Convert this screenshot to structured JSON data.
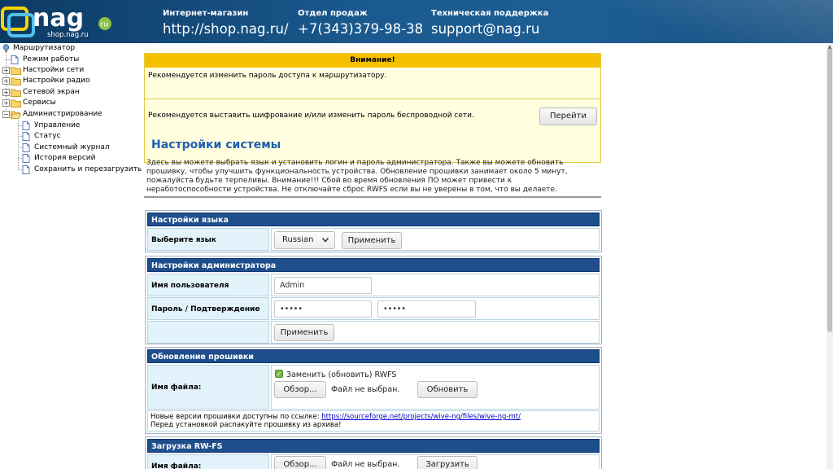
{
  "header": {
    "logo_text": "nag",
    "logo_ru": "ru",
    "logo_sub": "shop.nag.ru",
    "shop": {
      "title": "Интернет-магазин",
      "value": "http://shop.nag.ru/"
    },
    "sales": {
      "title": "Отдел продаж",
      "value": "+7(343)379-98-38"
    },
    "support": {
      "title": "Техническая поддержка",
      "value": "support@nag.ru"
    }
  },
  "tree": {
    "root": "Маршрутизатор",
    "items": [
      {
        "label": "Режим работы"
      },
      {
        "label": "Настройки сети"
      },
      {
        "label": "Настройки радио"
      },
      {
        "label": "Сетевой экран"
      },
      {
        "label": "Сервисы"
      },
      {
        "label": "Администрирование"
      },
      {
        "label": "Управление"
      },
      {
        "label": "Статус"
      },
      {
        "label": "Системный журнал"
      },
      {
        "label": "История версий"
      },
      {
        "label": "Сохранить и перезагрузить"
      }
    ]
  },
  "warning": {
    "title": "Внимание!",
    "msg1": "Рекомендуется изменить пароль доступа к маршрутизатору.",
    "msg2": "Рекомендуется выставить шифрование и/или изменить пароль беспроводной сети.",
    "go_button": "Перейти"
  },
  "system": {
    "title": "Настройки системы",
    "description": "Здесь вы можете выбрать язык и установить логин и пароль администратора. Также вы можете обновить прошивку, чтобы улучшить функциональность устройства. Обновление прошивки занимает около 5 минут, пожалуйста будьте терпеливы. Внимание!!! Сбой во время обновления ПО может привести к неработоспособности устройства. Не отключайте сброс RWFS если вы не уверены в том, что вы делаете."
  },
  "language": {
    "header": "Настройки языка",
    "label": "Выберите язык",
    "selected": "Russian",
    "apply": "Применить"
  },
  "admin": {
    "header": "Настройки администратора",
    "user_label": "Имя пользователя",
    "user_value": "Admin",
    "pass_label": "Пароль / Подтверждение",
    "pass_value": "•••••",
    "pass_confirm": "•••••",
    "apply": "Применить"
  },
  "firmware": {
    "header": "Обновление прошивки",
    "file_label": "Имя файла:",
    "rwfs_label": "Заменить (обновить) RWFS",
    "browse": "Обзор...",
    "no_file": "Файл не выбран.",
    "update": "Обновить",
    "note_prefix": "Новые версии прошивки доступны по ссылке:",
    "note_link": "https://sourceforge.net/projects/wive-ng/files/wive-ng-mt/",
    "note_2": "Перед установкой распакуйте прошивку из архива!"
  },
  "rwfs": {
    "header": "Загрузка RW-FS",
    "file_label": "Имя файла:",
    "browse": "Обзор...",
    "no_file": "Файл не выбран.",
    "upload": "Загрузить"
  }
}
